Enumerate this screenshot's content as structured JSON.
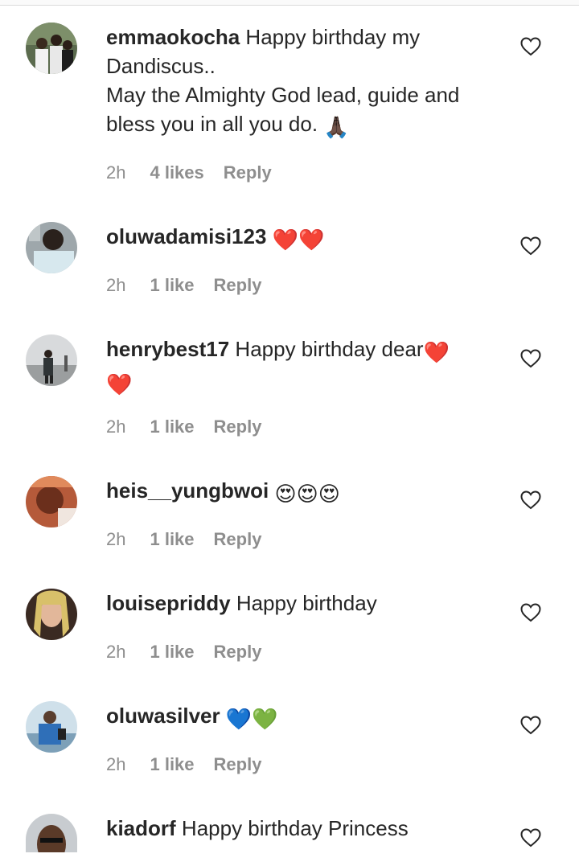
{
  "comments": [
    {
      "username": "emmaokocha",
      "text": "Happy birthday my Dandiscus..",
      "text_line2": "May the Almighty God lead, guide and bless you in all you do.",
      "emoji": "🙏🏿",
      "time": "2h",
      "likes": "4 likes",
      "reply": "Reply"
    },
    {
      "username": "oluwadamisi123",
      "text": "",
      "emoji": "❤️❤️",
      "time": "2h",
      "likes": "1 like",
      "reply": "Reply"
    },
    {
      "username": "henrybest17",
      "text": "Happy birthday dear",
      "emoji": "❤️",
      "emoji_line2": "❤️",
      "time": "2h",
      "likes": "1 like",
      "reply": "Reply"
    },
    {
      "username": "heis__yungbwoi",
      "text": "",
      "emoji": "😍😍😍",
      "time": "2h",
      "likes": "1 like",
      "reply": "Reply"
    },
    {
      "username": "louisepriddy",
      "text": "Happy birthday",
      "time": "2h",
      "likes": "1 like",
      "reply": "Reply"
    },
    {
      "username": "oluwasilver",
      "text": "",
      "emoji": "💙💚",
      "time": "2h",
      "likes": "1 like",
      "reply": "Reply"
    },
    {
      "username": "kiadorf",
      "text": "Happy birthday Princess"
    }
  ],
  "colors": {
    "text": "#262626",
    "meta": "#8e8e8e",
    "heart_outline": "#262626"
  },
  "icons": {
    "like": "heart-outline-icon"
  }
}
